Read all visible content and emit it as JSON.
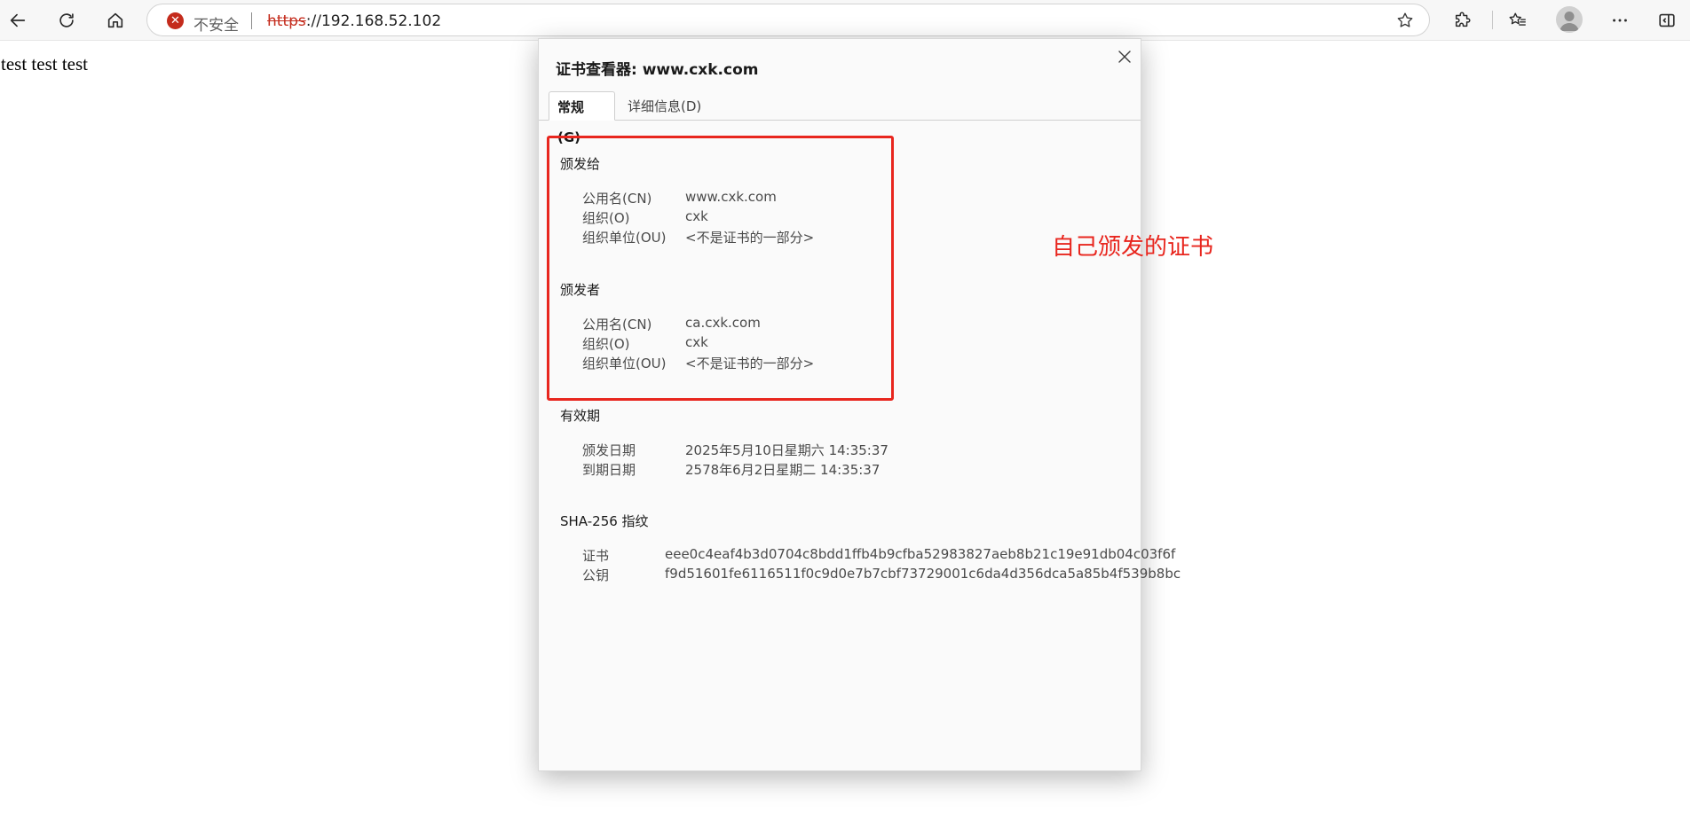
{
  "browser": {
    "security_label": "不安全",
    "url_scheme": "https",
    "url_rest": "://192.168.52.102"
  },
  "page": {
    "body_text": "test test test"
  },
  "dialog": {
    "title": "证书查看器: www.cxk.com",
    "tabs": [
      {
        "label": "常规(G)",
        "active": true
      },
      {
        "label": "详细信息(D)",
        "active": false
      }
    ],
    "issued_to": {
      "heading": "颁发给",
      "rows": [
        {
          "label": "公用名(CN)",
          "value": "www.cxk.com"
        },
        {
          "label": "组织(O)",
          "value": "cxk"
        },
        {
          "label": "组织单位(OU)",
          "value": "<不是证书的一部分>"
        }
      ]
    },
    "issued_by": {
      "heading": "颁发者",
      "rows": [
        {
          "label": "公用名(CN)",
          "value": "ca.cxk.com"
        },
        {
          "label": "组织(O)",
          "value": "cxk"
        },
        {
          "label": "组织单位(OU)",
          "value": "<不是证书的一部分>"
        }
      ]
    },
    "validity": {
      "heading": "有效期",
      "rows": [
        {
          "label": "颁发日期",
          "value": "2025年5月10日星期六 14:35:37"
        },
        {
          "label": "到期日期",
          "value": "2578年6月2日星期二 14:35:37"
        }
      ]
    },
    "fingerprints": {
      "heading": "SHA-256 指纹",
      "rows": [
        {
          "label": "证书",
          "value": "eee0c4eaf4b3d0704c8bdd1ffb4b9cfba52983827aeb8b21c19e91db04c03f6f"
        },
        {
          "label": "公钥",
          "value": "f9d51601fe6116511f0c9d0e7b7cbf73729001c6da4d356dca5a85b4f539b8bc"
        }
      ]
    }
  },
  "annotation": {
    "text": "自己颁发的证书",
    "color": "#e8261e"
  },
  "icons": [
    "back-icon",
    "refresh-icon",
    "home-icon",
    "not-secure-icon",
    "favorite-star-icon",
    "extensions-icon",
    "favorites-icon",
    "profile-avatar-icon",
    "more-icon",
    "sidebar-icon",
    "close-icon"
  ]
}
